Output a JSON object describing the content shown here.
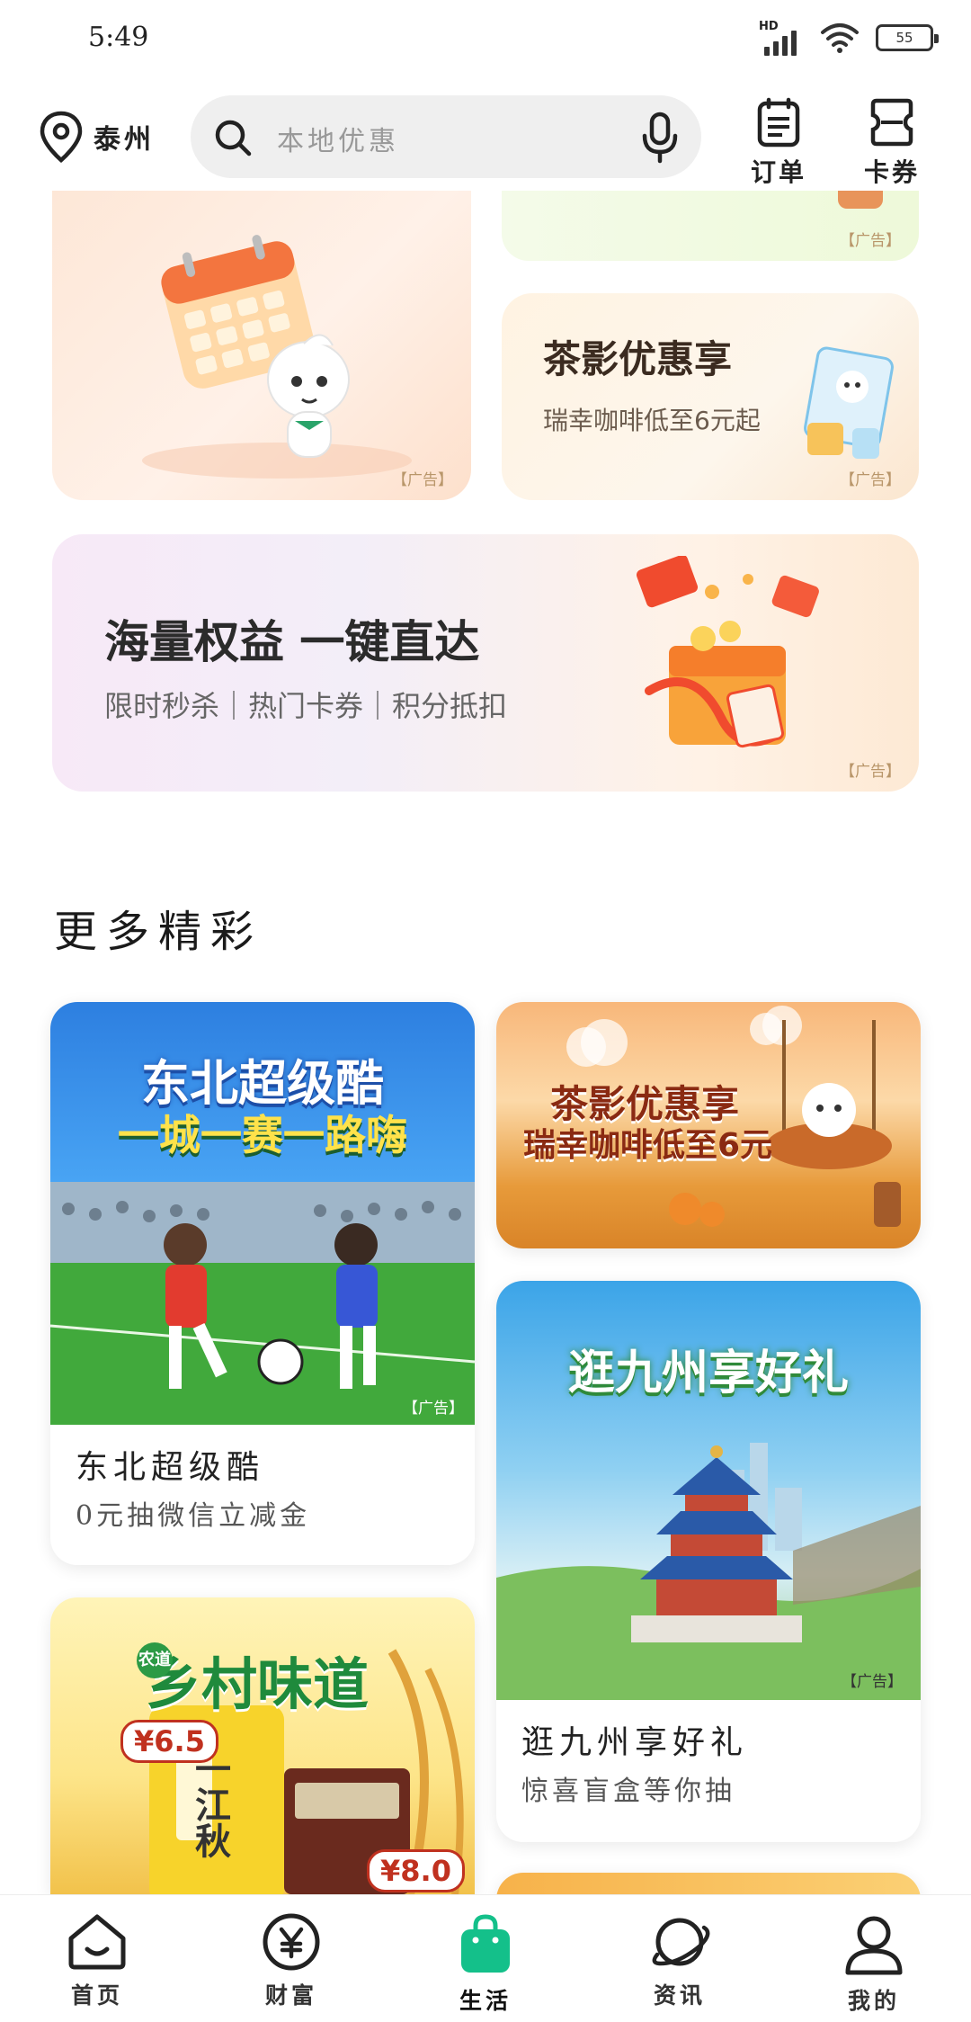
{
  "status_bar": {
    "time": "5:49",
    "network": "HD",
    "battery": "55"
  },
  "top_bar": {
    "location": "泰州",
    "search_placeholder": "本地优惠",
    "actions": [
      {
        "label": "订单"
      },
      {
        "label": "卡券"
      }
    ]
  },
  "cards": {
    "ad_label": "【广告】",
    "tea_promo": {
      "title": "茶影优惠享",
      "subtitle": "瑞幸咖啡低至6元起"
    },
    "banner": {
      "title": "海量权益 一键直达",
      "subtitle": "限时秒杀｜热门卡券｜积分抵扣"
    }
  },
  "section_title": "更多精彩",
  "feed": [
    {
      "poster_line1": "东北超级酷",
      "poster_line2": "一城一赛一路嗨",
      "title": "东北超级酷",
      "subtitle": "0元抽微信立减金"
    },
    {
      "poster_line1": "茶影优惠享",
      "poster_line2": "瑞幸咖啡低至6元"
    },
    {
      "poster_line1": "逛九州享好礼",
      "title": "逛九州享好礼",
      "subtitle": "惊喜盲盒等你抽"
    },
    {
      "poster_line1": "乡村味道",
      "badge": "农道",
      "price1": "¥6.5",
      "price2": "¥8.0",
      "product": "一江秋"
    }
  ],
  "bottom_nav": [
    {
      "label": "首页",
      "icon": "home-icon"
    },
    {
      "label": "财富",
      "icon": "yen-icon"
    },
    {
      "label": "生活",
      "icon": "shopping-bag-icon",
      "active": true
    },
    {
      "label": "资讯",
      "icon": "planet-icon"
    },
    {
      "label": "我的",
      "icon": "user-icon"
    }
  ],
  "colors": {
    "accent": "#14c08a",
    "text": "#222222",
    "search_bg": "#efefef"
  }
}
